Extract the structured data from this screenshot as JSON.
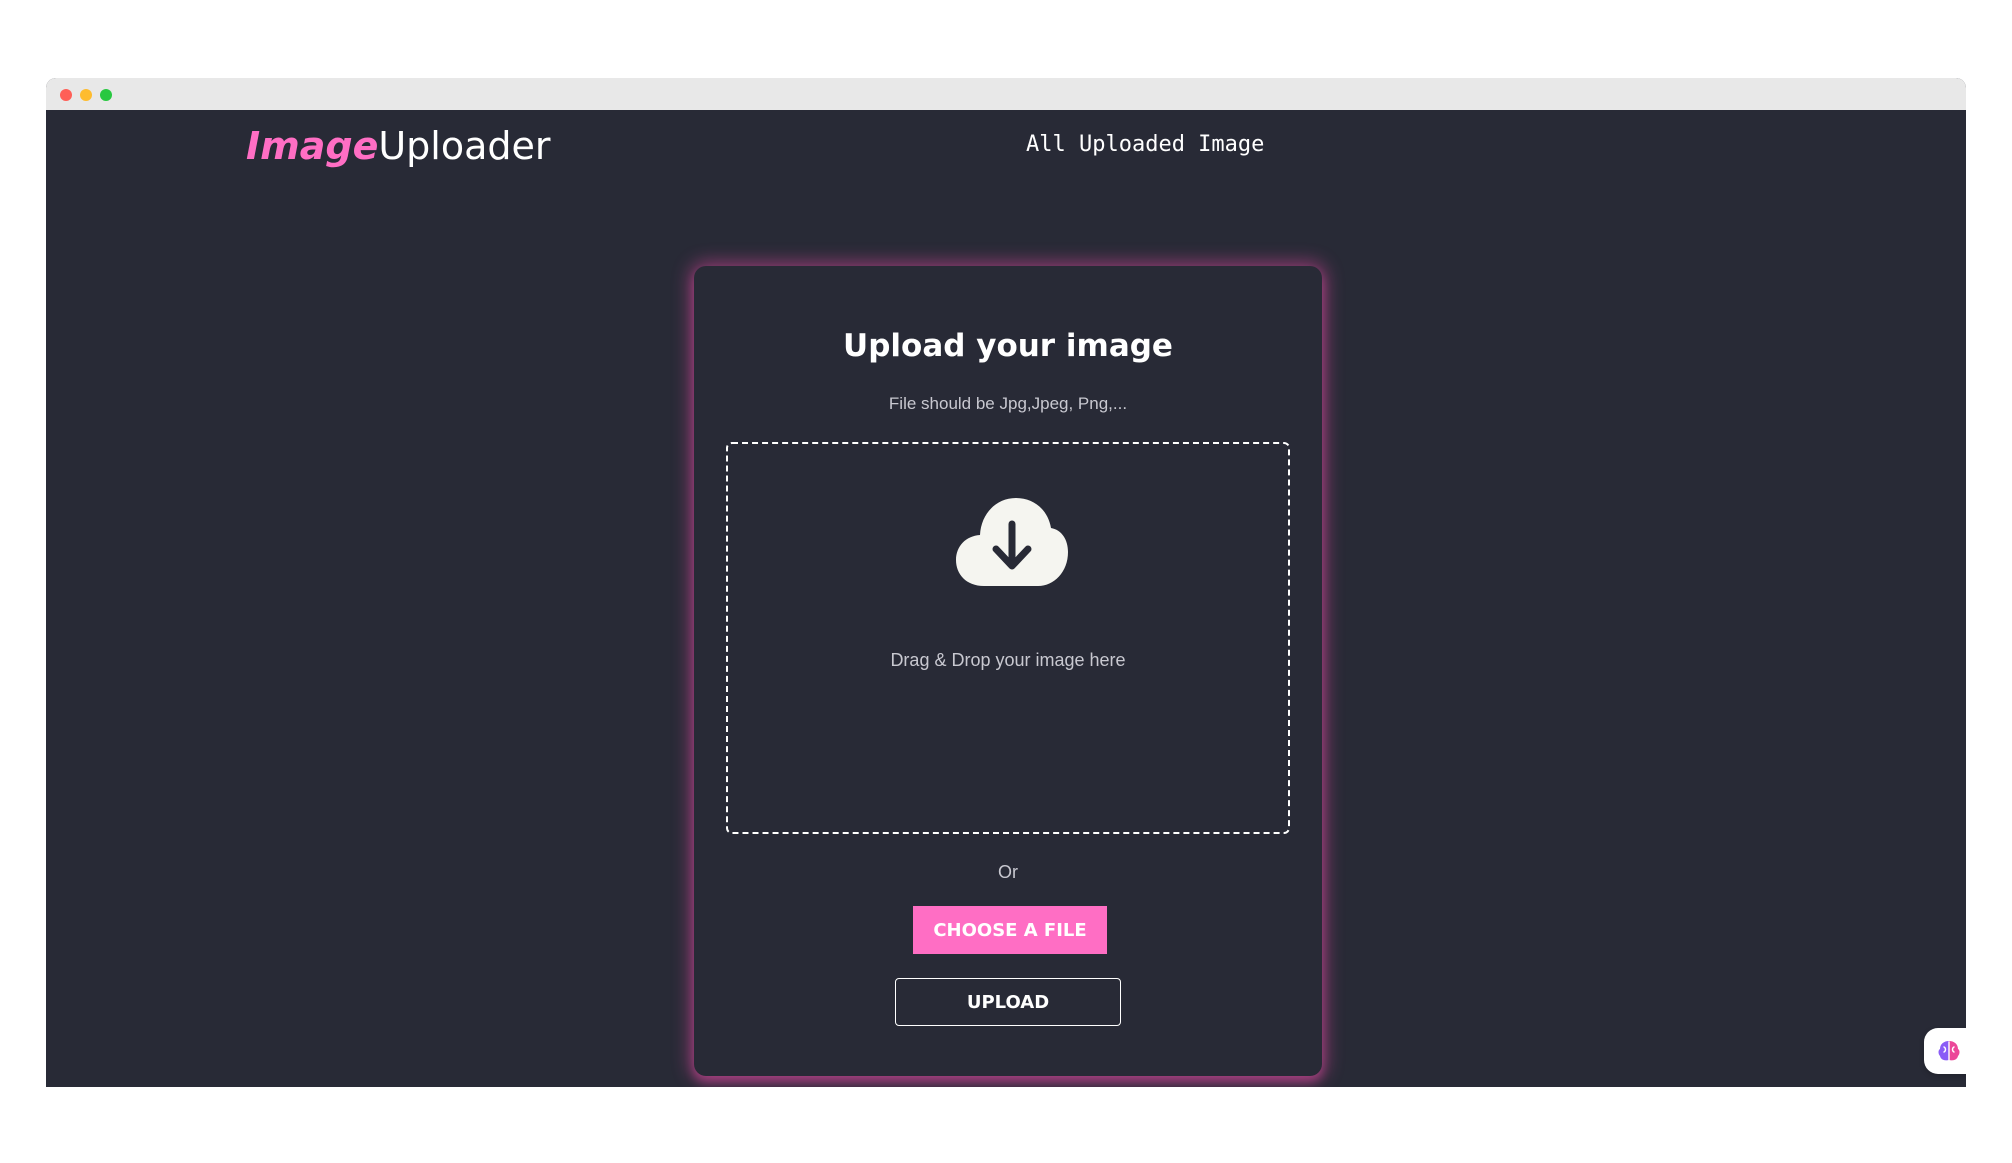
{
  "header": {
    "logo_accent": "Image",
    "logo_rest": "Uploader",
    "nav_link": "All Uploaded Image"
  },
  "card": {
    "title": "Upload your image",
    "subtitle": "File should be Jpg,Jpeg, Png,...",
    "dropzone_text": "Drag & Drop your image here",
    "or_text": "Or",
    "choose_button": "CHOOSE A FILE",
    "upload_button": "UPLOAD"
  },
  "icons": {
    "dropzone_icon": "cloud-download-icon",
    "widget_icon": "brain-icon"
  },
  "colors": {
    "background": "#282a36",
    "accent": "#ff6ec4",
    "text": "#ffffff",
    "muted_text": "#c8c8d0"
  }
}
